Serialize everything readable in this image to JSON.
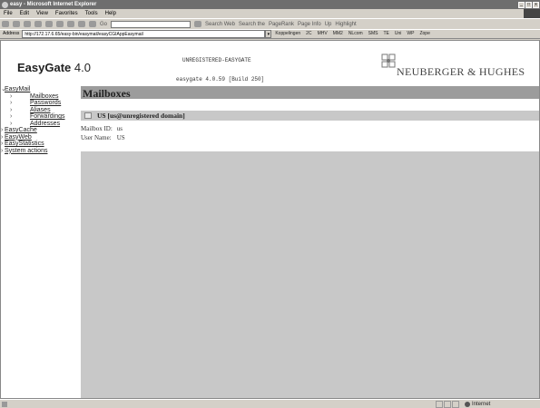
{
  "window": {
    "title": "easy - Microsoft Internet Explorer",
    "controls": [
      "_",
      "□",
      "x"
    ]
  },
  "menu": [
    "File",
    "Edit",
    "View",
    "Favorites",
    "Tools",
    "Help"
  ],
  "toolbar": {
    "go_label": "Go",
    "search_web": "Search Web",
    "search_bar": "Search the",
    "pagerank": "PageRank",
    "page_info": "Page Info",
    "up": "Up",
    "highlight": "Highlight"
  },
  "address": {
    "label": "Address",
    "url": "http://172.17.6.65/easy-bin/easymail/easyCGIAppEasymail",
    "links_label": "Koppelingen",
    "links": [
      "2C",
      "MHV",
      "MM2",
      "NLcom",
      "SMS",
      "TE",
      "Uni",
      "WP",
      "Zope"
    ]
  },
  "header": {
    "brand": "EasyGate",
    "version": "4.0",
    "unregistered": "UNREGISTERED-EASYGATE",
    "build": "easygate 4.0.59 [Build 250]",
    "company": "NEUBERGER & HUGHES"
  },
  "sidebar": {
    "easymail": "EasyMail",
    "sub": [
      "Mailboxes",
      "Passwords",
      "Aliases",
      "Forwardings",
      "Addresses"
    ],
    "others": [
      "EasyCache",
      "EasyWeb",
      "EasyStatistics",
      "System actions"
    ]
  },
  "main": {
    "title": "Mailboxes",
    "mailbox_title": "US [us@unregistered domain]",
    "fields": [
      {
        "label": "Mailbox ID:",
        "value": "us"
      },
      {
        "label": "User Name:",
        "value": "US"
      }
    ]
  },
  "status": {
    "zone": "Internet"
  }
}
